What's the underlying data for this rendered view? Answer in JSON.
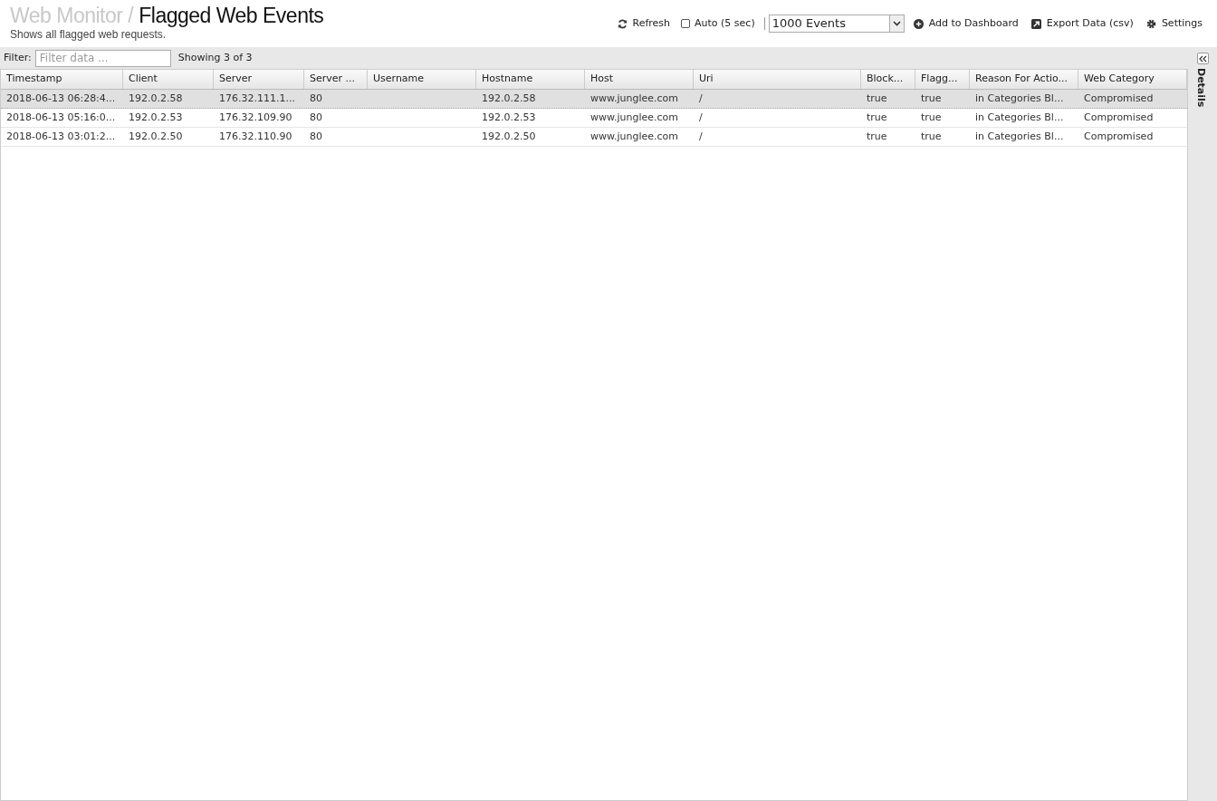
{
  "header": {
    "breadcrumb": "Web Monitor /",
    "title": "Flagged Web Events",
    "subtitle": "Shows all flagged web requests."
  },
  "toolbar": {
    "refresh": "Refresh",
    "auto": {
      "label": "Auto (5 sec)",
      "checked": false
    },
    "events_select": "1000 Events",
    "add_dashboard": "Add to Dashboard",
    "export": "Export Data (csv)",
    "settings": "Settings"
  },
  "filter": {
    "label": "Filter:",
    "placeholder": "Filter data ...",
    "count": "Showing 3 of 3"
  },
  "table": {
    "columns": [
      "Timestamp",
      "Client",
      "Server",
      "Server ...",
      "Username",
      "Hostname",
      "Host",
      "Uri",
      "Block...",
      "Flagg...",
      "Reason For Actio...",
      "Web Category"
    ],
    "rows": [
      {
        "selected": true,
        "cells": [
          "2018-06-13 06:28:4...",
          "192.0.2.58",
          "176.32.111.1...",
          "80",
          null,
          "192.0.2.58",
          "www.junglee.com",
          "/",
          "true",
          "true",
          "in Categories Bl...",
          "Compromised"
        ]
      },
      {
        "selected": false,
        "cells": [
          "2018-06-13 05:16:0...",
          "192.0.2.53",
          "176.32.109.90",
          "80",
          null,
          "192.0.2.53",
          "www.junglee.com",
          "/",
          "true",
          "true",
          "in Categories Bl...",
          "Compromised"
        ]
      },
      {
        "selected": false,
        "cells": [
          "2018-06-13 03:01:2...",
          "192.0.2.50",
          "176.32.110.90",
          "80",
          null,
          "192.0.2.50",
          "www.junglee.com",
          "/",
          "true",
          "true",
          "in Categories Bl...",
          "Compromised"
        ]
      }
    ]
  },
  "details_panel": {
    "label": "Details"
  }
}
